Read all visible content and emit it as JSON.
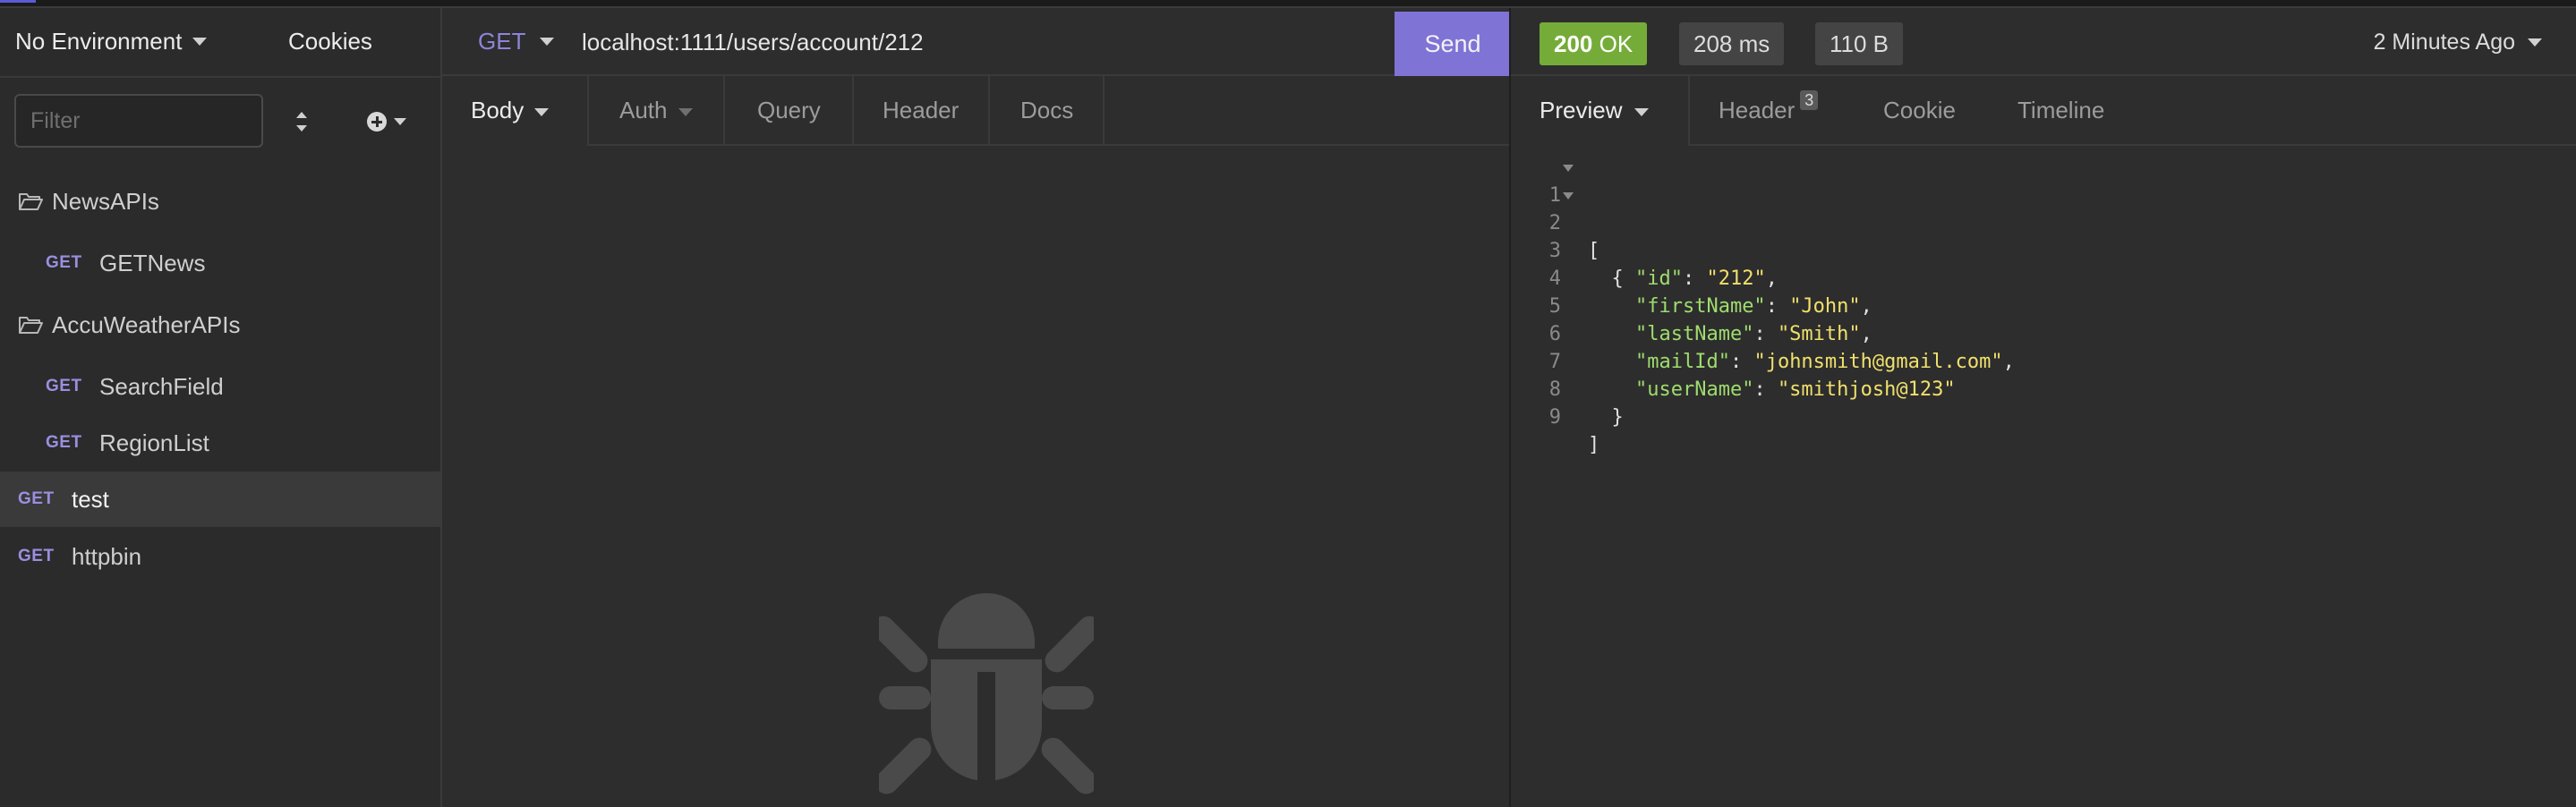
{
  "sidebar": {
    "environment": "No Environment",
    "cookies": "Cookies",
    "filter_placeholder": "Filter",
    "items": [
      {
        "type": "folder",
        "label": "NewsAPIs"
      },
      {
        "type": "request",
        "method": "GET",
        "label": "GETNews"
      },
      {
        "type": "folder",
        "label": "AccuWeatherAPIs"
      },
      {
        "type": "request",
        "method": "GET",
        "label": "SearchField"
      },
      {
        "type": "request",
        "method": "GET",
        "label": "RegionList"
      },
      {
        "type": "request",
        "method": "GET",
        "label": "test",
        "active": true
      },
      {
        "type": "request",
        "method": "GET",
        "label": "httpbin"
      }
    ]
  },
  "request": {
    "method": "GET",
    "url": "localhost:1111/users/account/212",
    "send_label": "Send",
    "tabs": [
      "Body",
      "Auth",
      "Query",
      "Header",
      "Docs"
    ]
  },
  "response": {
    "status_code": "200",
    "status_text": "OK",
    "time": "208 ms",
    "size": "110 B",
    "age": "2 Minutes Ago",
    "tabs": [
      "Preview",
      "Header",
      "Cookie",
      "Timeline"
    ],
    "header_count": "3",
    "body_lines": [
      {
        "num": "1",
        "text": "["
      },
      {
        "num": "2",
        "text": "  {"
      },
      {
        "num": "3",
        "key": "\"id\"",
        "value": "\"212\"",
        "trail": ","
      },
      {
        "num": "4",
        "key": "\"firstName\"",
        "value": "\"John\"",
        "trail": ","
      },
      {
        "num": "5",
        "key": "\"lastName\"",
        "value": "\"Smith\"",
        "trail": ","
      },
      {
        "num": "6",
        "key": "\"mailId\"",
        "value": "\"johnsmith@gmail.com\"",
        "trail": ","
      },
      {
        "num": "7",
        "key": "\"userName\"",
        "value": "\"smithjosh@123\"",
        "trail": ""
      },
      {
        "num": "8",
        "text": "  }"
      },
      {
        "num": "9",
        "text": "]"
      }
    ]
  },
  "colors": {
    "accent": "#7f73d6",
    "method": "#9a8fe0",
    "status_ok": "#75ac39",
    "json_key": "#9fdc6e",
    "json_string": "#f0e06c"
  },
  "icons": [
    "chevron-down-icon",
    "sort-icon",
    "add-circle-icon",
    "folder-open-icon",
    "bug-icon",
    "fold-arrow-icon"
  ]
}
